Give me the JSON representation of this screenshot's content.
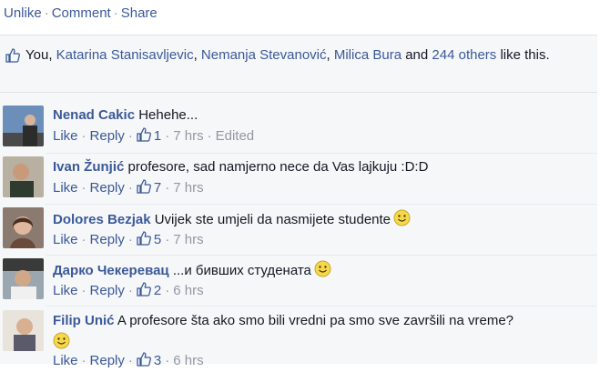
{
  "post_actions": {
    "unlike": "Unlike",
    "comment": "Comment",
    "share": "Share",
    "separator": "·"
  },
  "likes": {
    "you": "You,",
    "names": [
      "Katarina Stanisavljevic",
      "Nemanja Stevanović",
      "Milica Bura"
    ],
    "and": "and",
    "others": "244 others",
    "suffix": "like this."
  },
  "comment_actions": {
    "like": "Like",
    "reply": "Reply"
  },
  "comments": [
    {
      "author": "Nenad Cakic",
      "text": "Hehehe...",
      "likes": "1",
      "time": "7 hrs",
      "edited": "Edited",
      "emoji": ""
    },
    {
      "author": "Ivan Žunjić",
      "text": "profesore, sad namjerno nece da Vas lajkuju :D:D",
      "likes": "7",
      "time": "7 hrs",
      "emoji": ""
    },
    {
      "author": "Dolores Bezjak",
      "text": "Uvijek ste umjeli da nasmijete studente",
      "likes": "5",
      "time": "7 hrs",
      "emoji": "smiley-icon"
    },
    {
      "author": "Дарко Чекеревац",
      "text": "...и бивших студената",
      "likes": "2",
      "time": "6 hrs",
      "emoji": "smiley-icon"
    },
    {
      "author": "Filip Unić",
      "text": "A profesore šta ako smo bili vredni pa smo sve završili na vreme?",
      "likes": "3",
      "time": "6 hrs",
      "emoji": "smiley-icon"
    }
  ],
  "colors": {
    "link": "#3b5998",
    "meta": "#9197a3",
    "background": "#f6f7f9"
  }
}
